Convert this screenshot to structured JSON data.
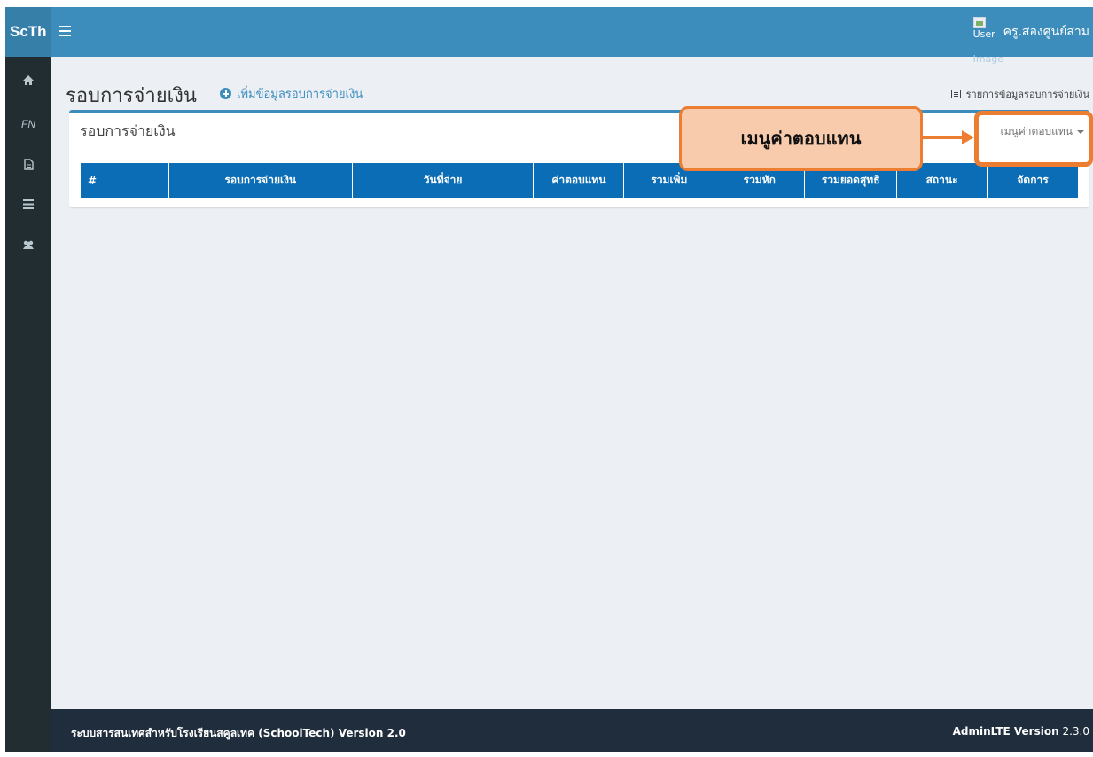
{
  "header": {
    "logo": "ScTh",
    "user_image_alt_line1": "User",
    "user_image_alt_line2": "Image",
    "user_name": "ครู.สองศูนย์สาม"
  },
  "sidebar": {
    "items": [
      {
        "icon": "home-icon"
      },
      {
        "label": "FN"
      },
      {
        "icon": "file-icon"
      },
      {
        "icon": "list-icon"
      },
      {
        "icon": "users-icon"
      }
    ]
  },
  "content": {
    "title": "รอบการจ่ายเงิน",
    "add_link": "เพิ่มข้อมูลรอบการจ่ายเงิน",
    "breadcrumb": "รายการข้อมูลรอบการจ่ายเงิน"
  },
  "box": {
    "title": "รอบการจ่ายเงิน",
    "menu_label": "เมนูค่าตอบแทน",
    "columns": [
      "#",
      "รอบการจ่ายเงิน",
      "วันที่จ่าย",
      "ค่าตอบแทน",
      "รวมเพิ่ม",
      "รวมหัก",
      "รวมยอดสุทธิ",
      "สถานะ",
      "จัดการ"
    ]
  },
  "annotation": {
    "callout_text": "เมนูค่าตอบแทน"
  },
  "footer": {
    "left": "ระบบสารสนเทศสำหรับโรงเรียนสคูลเทค (SchoolTech) Version 2.0",
    "right_bold": "AdminLTE Version",
    "right_version": "2.3.0"
  },
  "colors": {
    "header": "#3c8dbc",
    "sidebar": "#222d32",
    "table_header": "#0a6db5",
    "annotation": "#ed7d31",
    "annotation_fill": "#f8cbad"
  }
}
